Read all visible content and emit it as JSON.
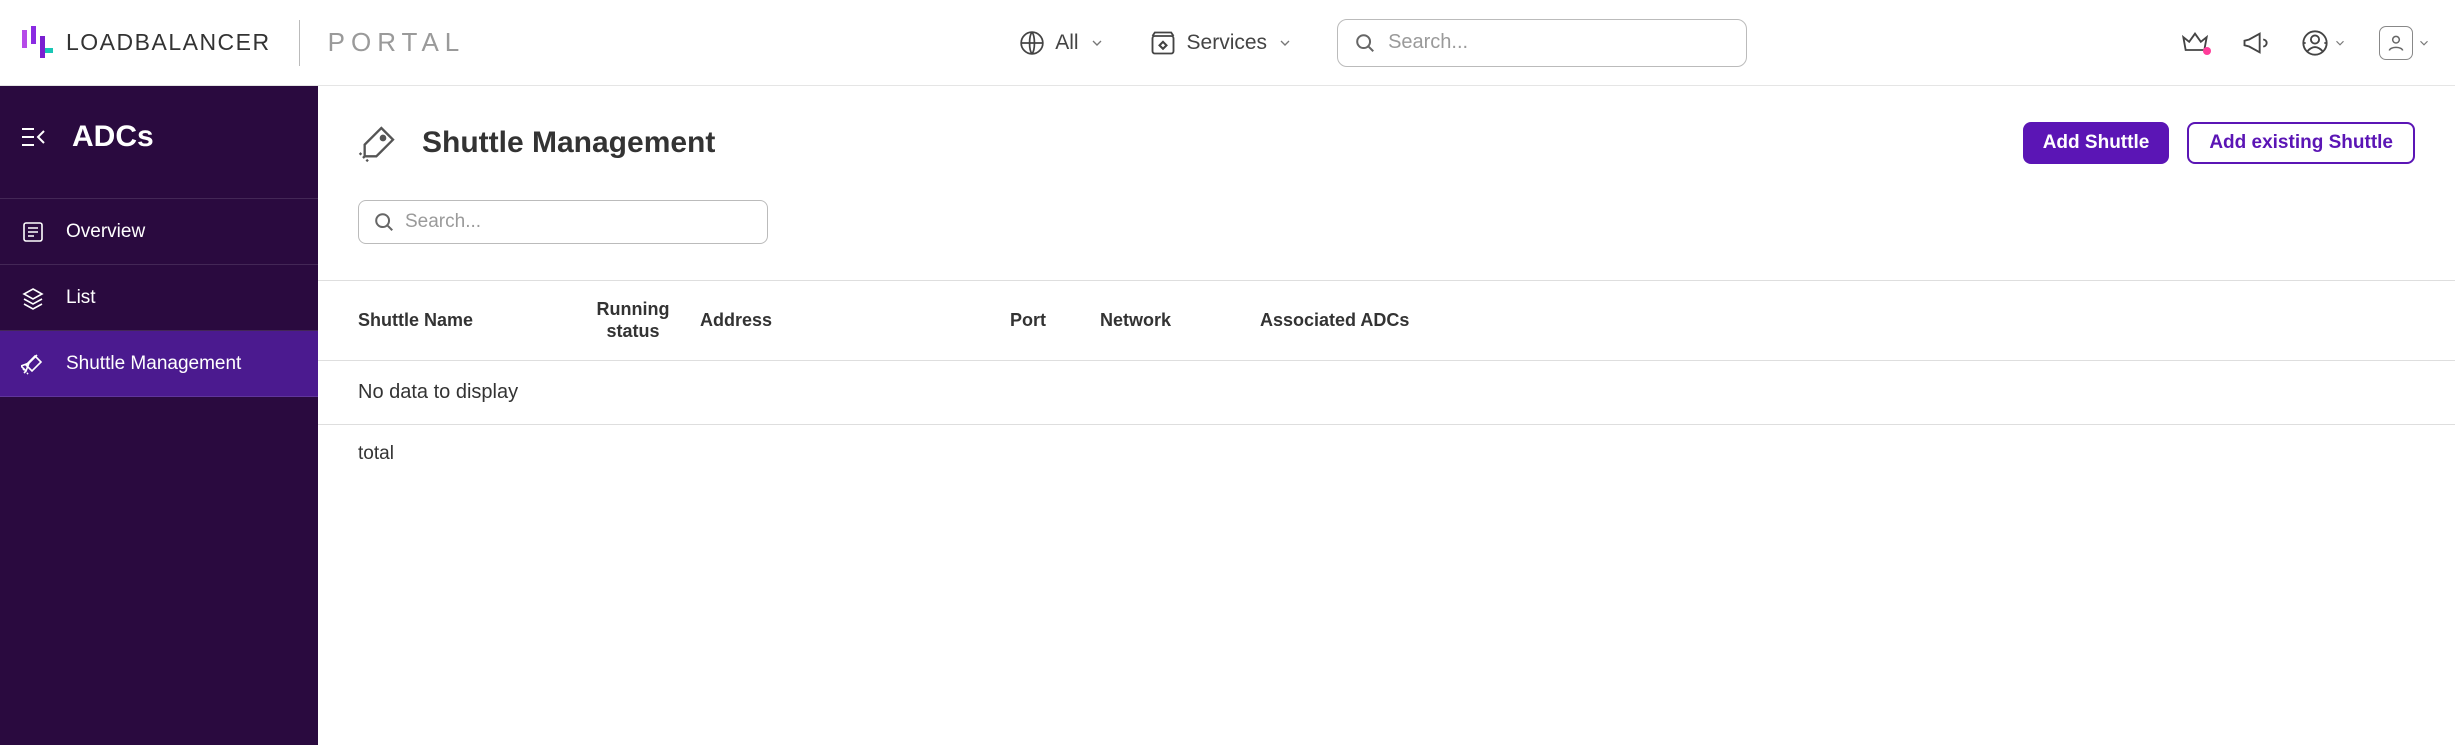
{
  "header": {
    "brand": "LOADBALANCER",
    "portal": "PORTAL",
    "scope_label": "All",
    "services_label": "Services",
    "search_placeholder": "Search..."
  },
  "sidebar": {
    "title": "ADCs",
    "items": [
      {
        "label": "Overview"
      },
      {
        "label": "List"
      },
      {
        "label": "Shuttle Management"
      }
    ]
  },
  "page": {
    "title": "Shuttle Management",
    "add_label": "Add Shuttle",
    "add_existing_label": "Add existing Shuttle",
    "search_placeholder": "Search..."
  },
  "table": {
    "columns": {
      "name": "Shuttle Name",
      "running_l1": "Running",
      "running_l2": "status",
      "address": "Address",
      "port": "Port",
      "network": "Network",
      "assoc": "Associated ADCs"
    },
    "empty_text": "No data to display",
    "footer_total": "total"
  }
}
